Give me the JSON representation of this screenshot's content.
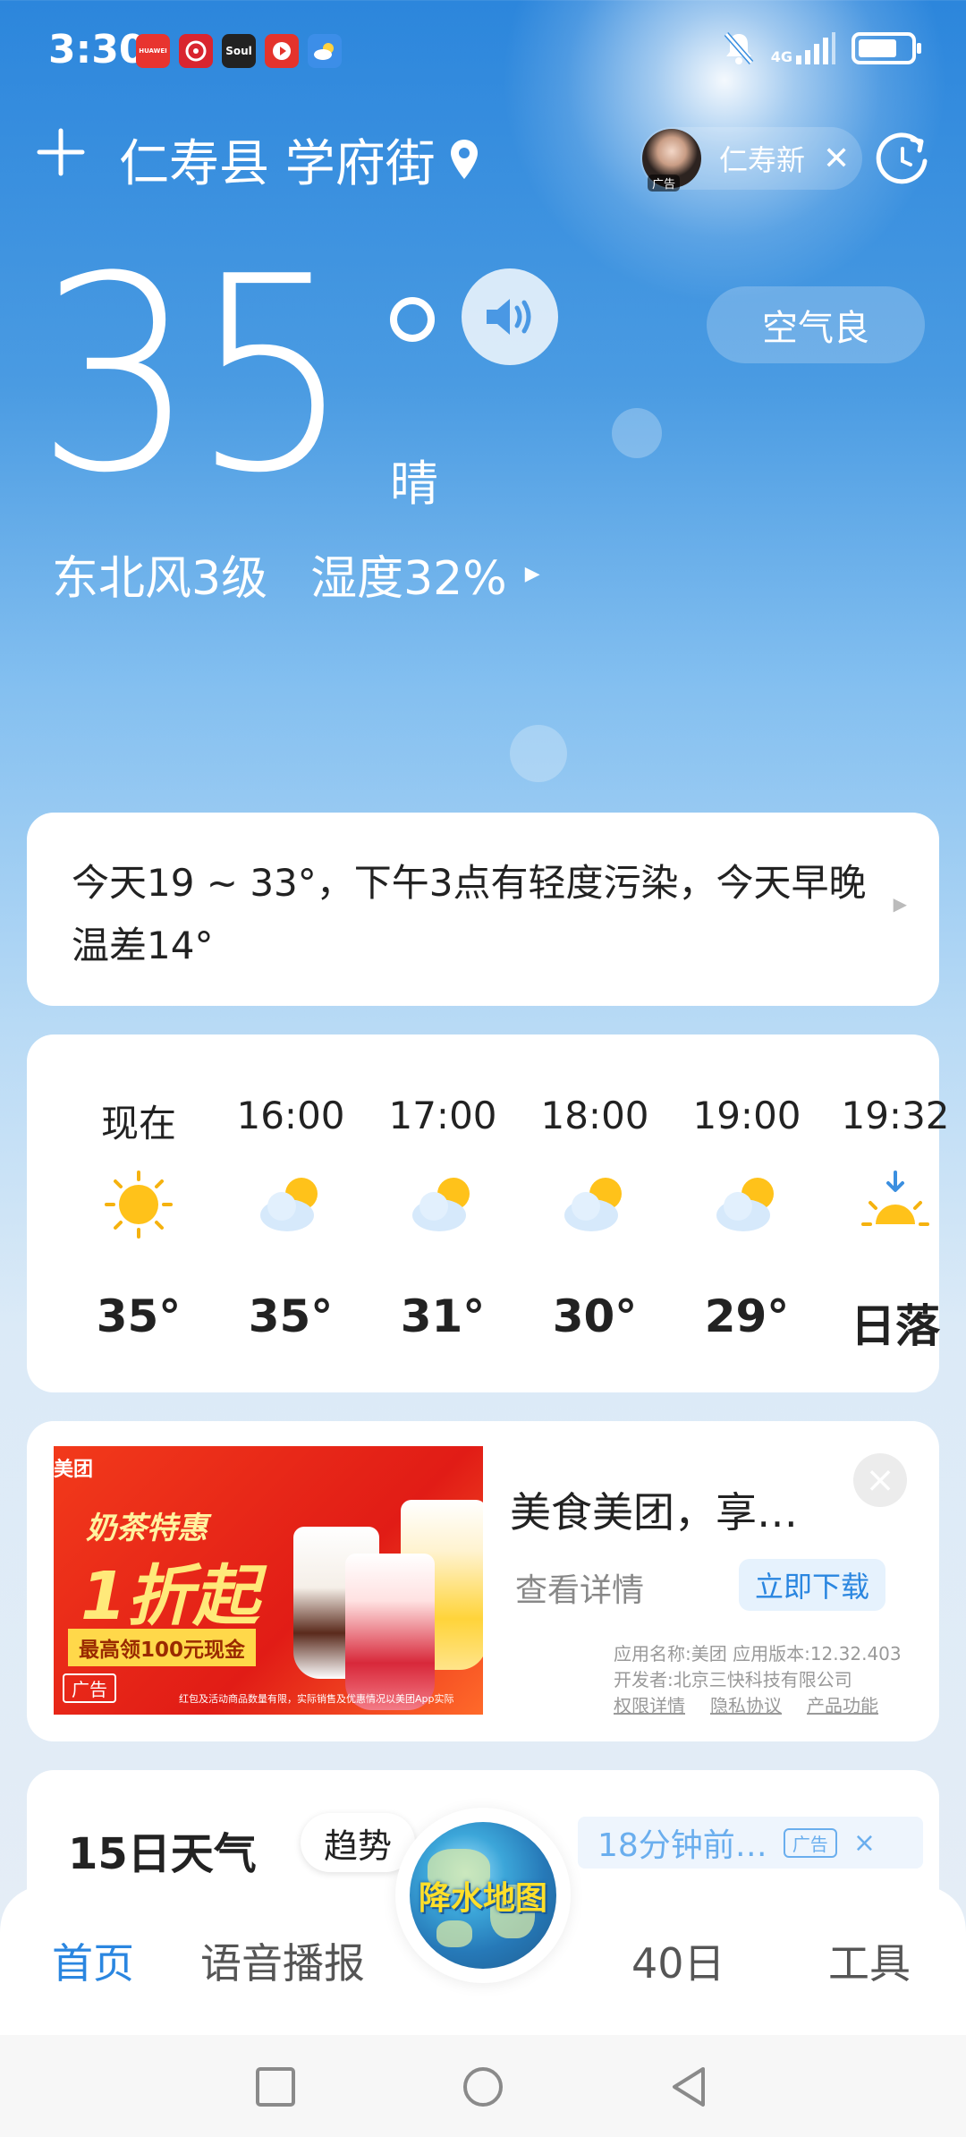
{
  "status_bar": {
    "time": "3:30",
    "notification_apps": [
      {
        "name": "huawei-appgallery-icon",
        "label": "HUAWEI",
        "color": "#e8342f"
      },
      {
        "name": "netease-music-icon",
        "label": "",
        "color": "#d9252f"
      },
      {
        "name": "soul-app-icon",
        "label": "Soul",
        "color": "#222222"
      },
      {
        "name": "video-app-icon",
        "label": "",
        "color": "#e4332c"
      },
      {
        "name": "weather-app-icon",
        "label": "",
        "color": "#3c8ee8"
      }
    ],
    "network": "4G",
    "battery_level": 0.8
  },
  "header": {
    "location": "仁寿县 学府街",
    "ad_name": "仁寿新",
    "ad_tag": "广告"
  },
  "current": {
    "temperature": "35",
    "condition": "晴",
    "air_quality": "空气良",
    "wind": "东北风3级",
    "humidity": "湿度32%"
  },
  "summary": {
    "text": "今天19 ~ 33°，下午3点有轻度污染，今天早晚温差14°"
  },
  "hourly": [
    {
      "time": "现在",
      "icon": "sun-icon",
      "temp": "35°"
    },
    {
      "time": "16:00",
      "icon": "partly-cloudy-icon",
      "temp": "35°"
    },
    {
      "time": "17:00",
      "icon": "partly-cloudy-icon",
      "temp": "31°"
    },
    {
      "time": "18:00",
      "icon": "partly-cloudy-icon",
      "temp": "30°"
    },
    {
      "time": "19:00",
      "icon": "partly-cloudy-icon",
      "temp": "29°"
    },
    {
      "time": "19:32",
      "icon": "sunset-icon",
      "temp": "日落"
    }
  ],
  "ad": {
    "banner_brand": "美团",
    "banner_line1": "奶茶特惠",
    "banner_line2": "1折起",
    "banner_line3": "最高领100元现金",
    "banner_tag": "广告",
    "banner_fine_print": "红包及活动商品数量有限，实际销售及优惠情况以美团App实际",
    "title": "美食美团，享…",
    "detail_label": "查看详情",
    "download_label": "立即下载",
    "meta_line1": "应用名称:美团    应用版本:12.32.403",
    "meta_line2": "开发者:北京三快科技有限公司",
    "links": [
      "权限详情",
      "隐私协议",
      "产品功能"
    ]
  },
  "forecast": {
    "title": "15日天气",
    "trend_label": "趋势",
    "ad_text": "18分钟前…",
    "ad_tag": "广告"
  },
  "bottom_nav": {
    "items": [
      "首页",
      "语音播报",
      "40日",
      "工具"
    ],
    "center_label": "降水地图"
  }
}
